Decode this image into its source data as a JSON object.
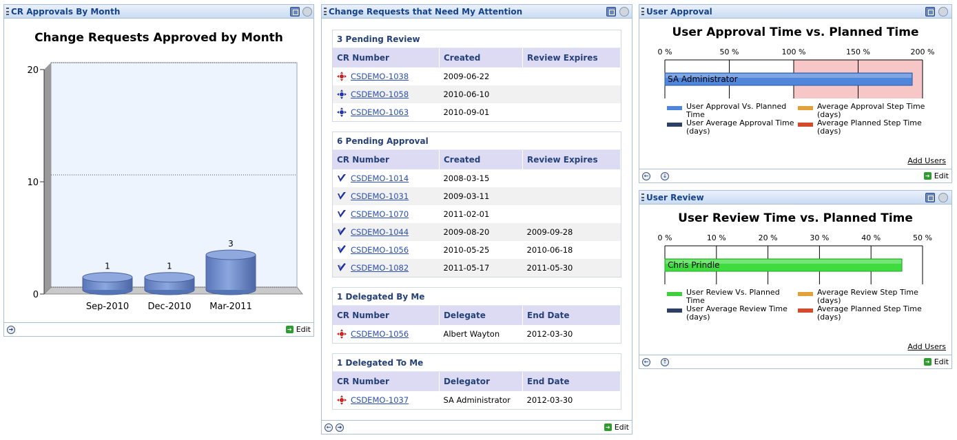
{
  "p1": {
    "title": "CR Approvals By Month",
    "chart_title": "Change Requests Approved by Month",
    "edit": "Edit",
    "chart_data": {
      "type": "bar",
      "categories": [
        "Sep-2010",
        "Dec-2010",
        "Mar-2011"
      ],
      "values": [
        1,
        1,
        3
      ],
      "title": "Change Requests Approved by Month",
      "ylim": [
        0,
        20
      ],
      "yticks": [
        "0",
        "10",
        "20"
      ],
      "grid": true
    }
  },
  "p2": {
    "title": "Change Requests that Need My Attention",
    "edit": "Edit",
    "sections": [
      {
        "header": "3 Pending Review",
        "columns": [
          "CR Number",
          "Created",
          "Review Expires"
        ],
        "rows": [
          {
            "icon": "review-red-icon",
            "c1": "CSDEMO-1038",
            "c2": "2009-06-22",
            "c3": ""
          },
          {
            "icon": "review-blue-icon",
            "c1": "CSDEMO-1058",
            "c2": "2010-06-10",
            "c3": ""
          },
          {
            "icon": "review-blue-icon",
            "c1": "CSDEMO-1063",
            "c2": "2010-09-01",
            "c3": ""
          }
        ]
      },
      {
        "header": "6 Pending Approval",
        "columns": [
          "CR Number",
          "Created",
          "Review Expires"
        ],
        "rows": [
          {
            "icon": "approval-check-icon",
            "c1": "CSDEMO-1014",
            "c2": "2008-03-15",
            "c3": ""
          },
          {
            "icon": "approval-check-icon",
            "c1": "CSDEMO-1031",
            "c2": "2009-03-11",
            "c3": ""
          },
          {
            "icon": "approval-check-icon",
            "c1": "CSDEMO-1070",
            "c2": "2011-02-01",
            "c3": ""
          },
          {
            "icon": "approval-double-check-icon",
            "c1": "CSDEMO-1044",
            "c2": "2009-08-20",
            "c3": "2009-09-28"
          },
          {
            "icon": "approval-double-check-icon",
            "c1": "CSDEMO-1056",
            "c2": "2010-05-25",
            "c3": "2010-06-18"
          },
          {
            "icon": "approval-double-check-icon",
            "c1": "CSDEMO-1082",
            "c2": "2011-05-17",
            "c3": "2011-05-30"
          }
        ]
      },
      {
        "header": "1 Delegated By Me",
        "columns": [
          "CR Number",
          "Delegate",
          "End Date"
        ],
        "rows": [
          {
            "icon": "review-red-icon",
            "c1": "CSDEMO-1056",
            "c2": "Albert Wayton",
            "c3": "2012-03-30"
          }
        ]
      },
      {
        "header": "1 Delegated To Me",
        "columns": [
          "CR Number",
          "Delegator",
          "End Date"
        ],
        "rows": [
          {
            "icon": "review-red-icon",
            "c1": "CSDEMO-1037",
            "c2": "SA Administrator",
            "c3": "2012-03-30"
          }
        ]
      }
    ]
  },
  "p3": {
    "title": "User Approval",
    "chart_title": "User Approval Time vs. Planned Time",
    "add_users": "Add Users",
    "edit": "Edit",
    "chart_data": {
      "type": "bar",
      "orientation": "horizontal",
      "xticks": [
        "0 %",
        "50 %",
        "100 %",
        "150 %",
        "200 %"
      ],
      "xlim": [
        0,
        200
      ],
      "bars": [
        {
          "label": "SA Administrator",
          "value": 192
        }
      ],
      "over_region_start": 100,
      "legend": [
        {
          "label": "User Approval Vs. Planned Time",
          "color": "#4f86d9"
        },
        {
          "label": "Average Approval Step Time (days)",
          "color": "#e2a23a"
        },
        {
          "label": "User Average Approval Time (days)",
          "color": "#2d3f63"
        },
        {
          "label": "Average Planned Step Time (days)",
          "color": "#d24b2c"
        }
      ]
    }
  },
  "p4": {
    "title": "User Review",
    "chart_title": "User Review Time vs. Planned Time",
    "add_users": "Add Users",
    "edit": "Edit",
    "chart_data": {
      "type": "bar",
      "orientation": "horizontal",
      "xticks": [
        "0 %",
        "10 %",
        "20 %",
        "30 %",
        "40 %",
        "50 %"
      ],
      "xlim": [
        0,
        50
      ],
      "bars": [
        {
          "label": "Chris Prindle",
          "value": 46
        }
      ],
      "legend": [
        {
          "label": "User Review Vs. Planned Time",
          "color": "#3fcf3f"
        },
        {
          "label": "Average Review Step Time (days)",
          "color": "#e2a23a"
        },
        {
          "label": "User Average Review Time (days)",
          "color": "#2d3f63"
        },
        {
          "label": "Average Planned Step Time (days)",
          "color": "#d24b2c"
        }
      ]
    }
  }
}
